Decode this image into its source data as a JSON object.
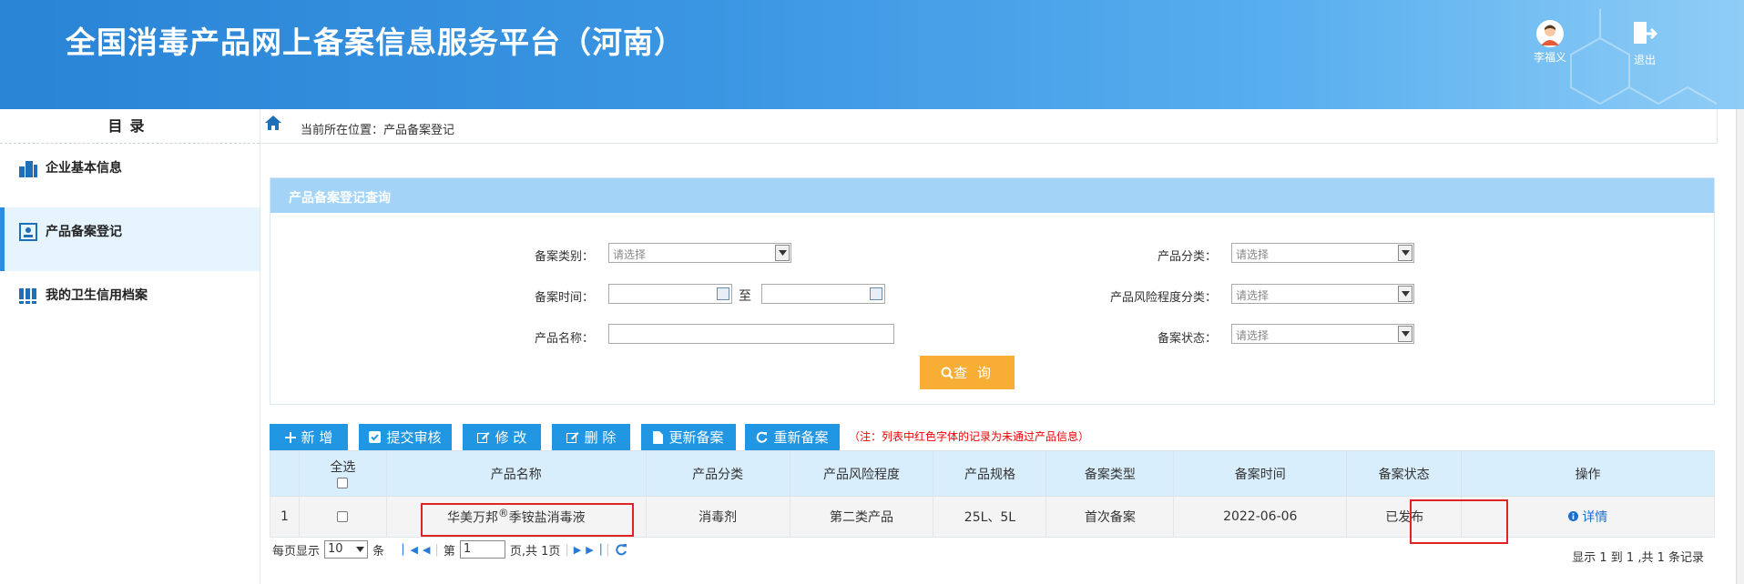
{
  "header": {
    "title": "全国消毒产品网上备案信息服务平台（河南）",
    "user_name": "李福义",
    "logout_label": "退出"
  },
  "sidebar": {
    "title": "目录",
    "items": [
      {
        "label": "企业基本信息",
        "icon": "building-icon",
        "active": false
      },
      {
        "label": "产品备案登记",
        "icon": "id-card-icon",
        "active": true
      },
      {
        "label": "我的卫生信用档案",
        "icon": "binders-icon",
        "active": false
      }
    ]
  },
  "breadcrumb": {
    "text": "当前所在位置：产品备案登记"
  },
  "query": {
    "panel_title": "产品备案登记查询",
    "filing_type_label": "备案类别：",
    "filing_type_value": "请选择",
    "filing_time_label": "备案时间：",
    "to_label": "至",
    "product_name_label": "产品名称：",
    "product_category_label": "产品分类：",
    "product_category_value": "请选择",
    "risk_level_label": "产品风险程度分类：",
    "risk_level_value": "请选择",
    "status_label": "备案状态：",
    "status_value": "请选择",
    "search_button": "查 询"
  },
  "toolbar": {
    "add": "新 增",
    "submit_review": "提交审核",
    "modify": "修 改",
    "delete": "删 除",
    "update_filing": "更新备案",
    "refile": "重新备案",
    "note": "（注：列表中红色字体的记录为未通过产品信息）"
  },
  "table": {
    "headers": {
      "select_all": "全选",
      "product_name": "产品名称",
      "category": "产品分类",
      "risk": "产品风险程度",
      "spec": "产品规格",
      "filing_type": "备案类型",
      "filing_time": "备案时间",
      "status": "备案状态",
      "actions": "操作"
    },
    "rows": [
      {
        "index": "1",
        "product_name_pre": "华美万邦",
        "product_name_mark": "®",
        "product_name_post": "季铵盐消毒液",
        "category": "消毒剂",
        "risk": "第二类产品",
        "spec": "25L、5L",
        "filing_type": "首次备案",
        "filing_time": "2022-06-06",
        "status": "已发布",
        "action": "详情"
      }
    ]
  },
  "pager": {
    "per_page_label": "每页显示",
    "per_page_value": "10",
    "items_unit": "条",
    "page_prefix": "第",
    "page_value": "1",
    "page_suffix": "页,共 1页",
    "summary": "显示 1 到 1 ,共 1 条记录"
  },
  "colors": {
    "header_blue": "#2a84d6",
    "accent_blue": "#2196e3",
    "query_orange": "#f8ad34",
    "highlight_red": "#e02424"
  }
}
